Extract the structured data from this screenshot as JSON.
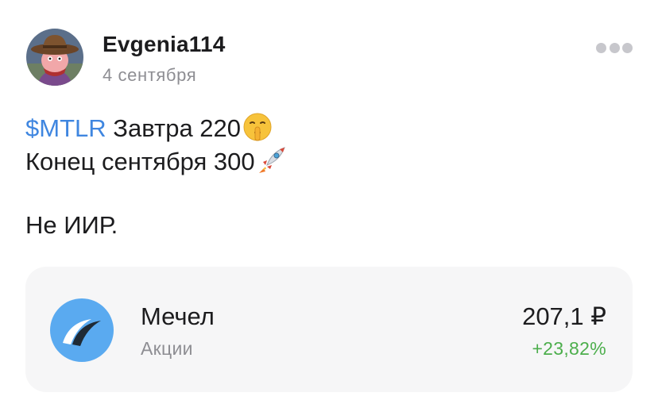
{
  "post": {
    "author": "Evgenia114",
    "date": "4 сентября",
    "avatar_icon": "cartoon-cowboy-avatar",
    "more_icon": "three-dots-icon",
    "body": {
      "ticker": "$MTLR",
      "line1_text": " Завтра 220",
      "line1_emoji": "shushing-face-emoji",
      "line2_text": "Конец сентября 300",
      "line2_emoji": "rocket-emoji",
      "line3_text": "Не ИИР."
    }
  },
  "instrument_card": {
    "name": "Мечел",
    "type": "Акции",
    "price": "207,1 ₽",
    "change": "+23,82%",
    "logo_icon": "mechel-logo",
    "colors": {
      "ticker": "#3f86e0",
      "change_positive": "#4cae4c",
      "logo_background": "#5aaaf0",
      "card_background": "#f6f6f7"
    }
  }
}
